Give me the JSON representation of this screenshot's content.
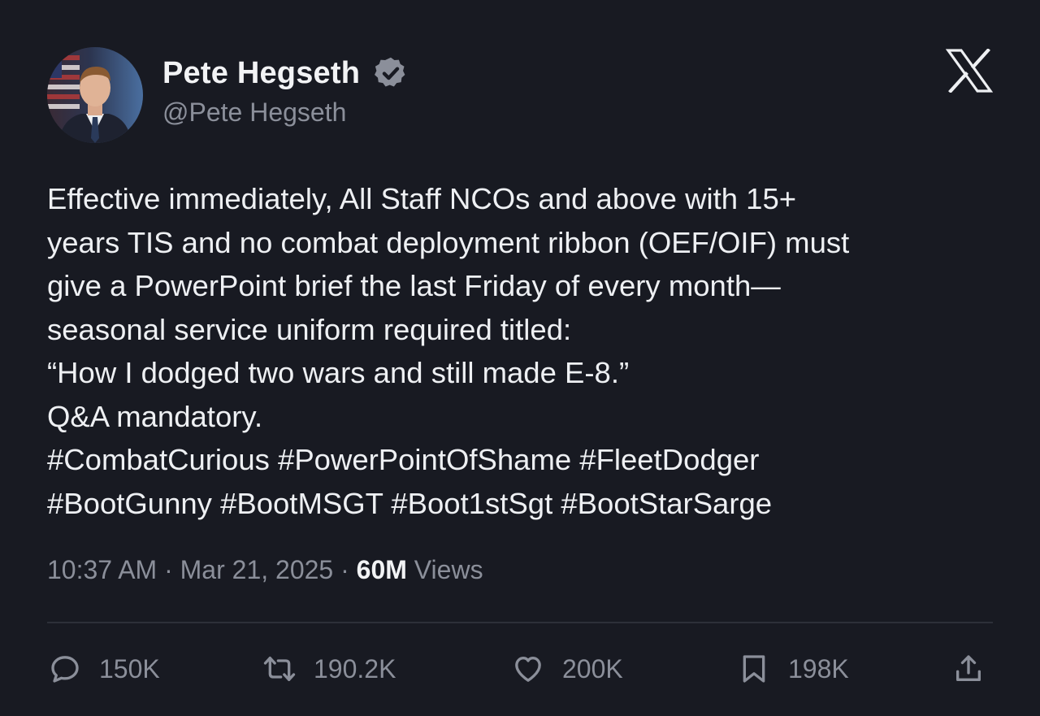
{
  "author": {
    "display_name": "Pete Hegseth",
    "handle": "@Pete Hegseth",
    "verified": true,
    "verified_badge_color": "#8b8f9a"
  },
  "platform_logo": "x-logo-icon",
  "post": {
    "lines": [
      "Effective immediately,  All Staff NCOs and above with 15+",
      "years TIS and no combat deployment ribbon (OEF/OIF) must",
      "give a PowerPoint brief the last Friday of every month—",
      "seasonal service uniform required titled:",
      "“How I dodged two wars and still made E-8.”",
      "Q&A mandatory.",
      "#CombatCurious #PowerPointOfShame #FleetDodger",
      "#BootGunny #BootMSGT #Boot1stSgt #BootStarSarge"
    ]
  },
  "meta": {
    "time": "10:37 AM",
    "separator": "·",
    "date": "Mar 21, 2025",
    "views_count": "60M",
    "views_label": "Views"
  },
  "actions": {
    "replies": "150K",
    "reposts": "190.2K",
    "likes": "200K",
    "bookmarks": "198K"
  },
  "colors": {
    "background": "#181a22",
    "text": "#eef0f3",
    "muted": "#8b8f9a",
    "divider": "#2d3039"
  }
}
